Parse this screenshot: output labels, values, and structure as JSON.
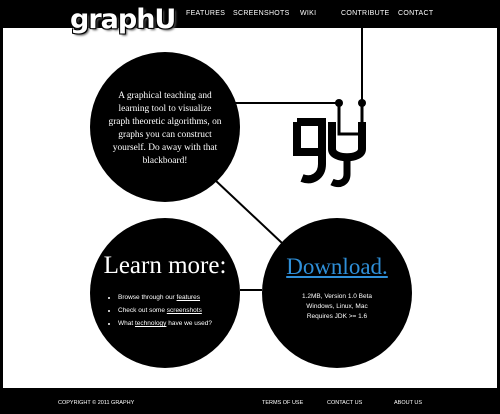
{
  "brand": {
    "logo_text": "graphU"
  },
  "nav": {
    "items": [
      {
        "label": "FEATURES"
      },
      {
        "label": "SCREENSHOTS"
      },
      {
        "label": "WIKI"
      },
      {
        "label": "CONTRIBUTE"
      },
      {
        "label": "CONTACT"
      }
    ]
  },
  "intro": {
    "text": "A graphical teaching and learning tool to visualize graph theoretic algorithms, on graphs you can construct yourself. Do away with that blackboard!"
  },
  "learn": {
    "heading": "Learn more:",
    "items": [
      {
        "before": "Browse through our ",
        "link": "features",
        "after": ""
      },
      {
        "before": "Check out some ",
        "link": "screenshots",
        "after": ""
      },
      {
        "before": "What ",
        "link": "technology",
        "after": " have we used?"
      }
    ]
  },
  "download": {
    "link": "Download.",
    "lines": [
      "1.2MB, Version 1.0 Beta",
      "Windows, Linux, Mac",
      "Requires JDK >= 1.6"
    ],
    "link_color": "#2f8fd8"
  },
  "footer": {
    "copyright": "COPYRIGHT © 2011 GRAPHY",
    "links": [
      {
        "label": "TERMS OF USE"
      },
      {
        "label": "CONTACT US"
      },
      {
        "label": "ABOUT US"
      }
    ]
  }
}
